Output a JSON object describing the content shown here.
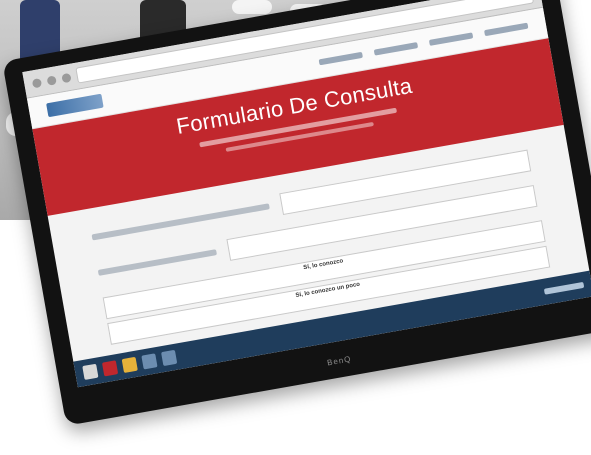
{
  "photo": {
    "description_colors": {
      "ground": "#bdbdbd",
      "accent_red": "#d4262f",
      "dark": "#2a2a2a"
    }
  },
  "browser": {
    "bar_color": "#dcdcdc"
  },
  "site": {
    "brand_color": "#3c6fa7",
    "hero_color": "#c1272d",
    "hero_title": "Formulario De Consulta",
    "submit_color": "#4a9fd8",
    "options": [
      "Sí, lo conozco",
      "Sí, lo conozco un poco"
    ]
  },
  "taskbar": {
    "color": "#1f3d5c"
  },
  "monitor": {
    "brand": "BenQ"
  }
}
